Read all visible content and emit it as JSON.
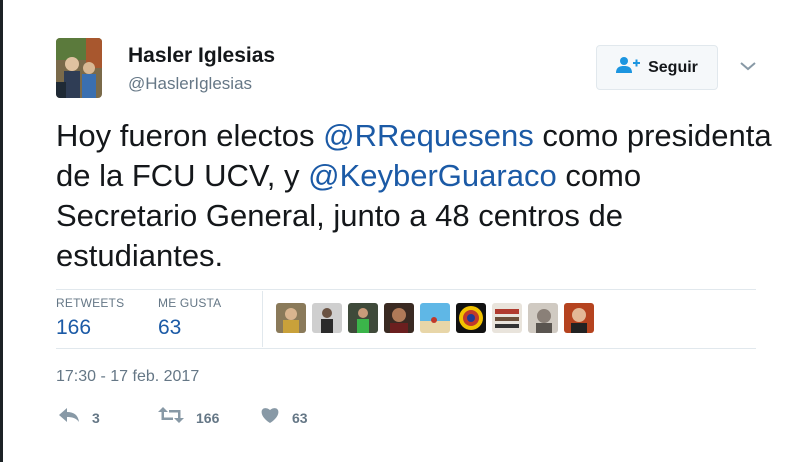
{
  "user": {
    "name": "Hasler Iglesias",
    "handle": "@HaslerIglesias"
  },
  "follow_button": {
    "label": "Seguir"
  },
  "tweet": {
    "text_1": "Hoy fueron electos ",
    "mention_1": "@RRequesens",
    "text_2": " como presidenta de la FCU UCV, y ",
    "mention_2": "@KeyberGuaraco",
    "text_3": " como Secretario General, junto a 48 centros de estudiantes."
  },
  "stats": {
    "retweets_label": "RETWEETS",
    "retweets_value": "166",
    "likes_label": "ME GUSTA",
    "likes_value": "63"
  },
  "timestamp": "17:30 - 17 feb. 2017",
  "actions": {
    "reply_count": "3",
    "retweet_count": "166",
    "like_count": "63"
  },
  "colors": {
    "link": "#1b5aa6",
    "secondary_text": "#657786",
    "icon": "#8899a6"
  }
}
